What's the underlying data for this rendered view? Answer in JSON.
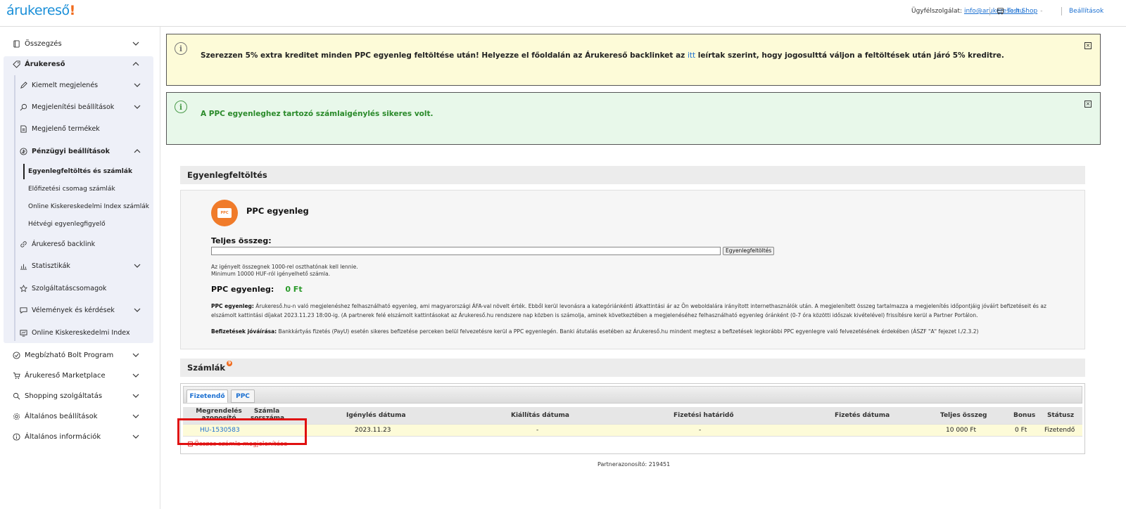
{
  "header": {
    "logo_text": "árukereső",
    "logo_bang": "!",
    "support_label": "Ügyfélszolgálat:",
    "support_email": "info@arukereso.hu",
    "shop_name": "Test Shop",
    "shop_suffix": "-",
    "settings_label": "Beállítások"
  },
  "sidebar": {
    "top_items": [
      {
        "label": "Összegzés",
        "icon": "summary-icon"
      },
      {
        "label": "Árukereső",
        "icon": "tag-icon"
      }
    ],
    "arukereso_sub": [
      {
        "label": "Kiemelt megjelenés",
        "icon": "pen-icon"
      },
      {
        "label": "Megjelenítési beállítások",
        "icon": "search-settings-icon"
      },
      {
        "label": "Megjelenő termékek",
        "icon": "document-icon"
      },
      {
        "label": "Pénzügyi beállítások",
        "icon": "money-icon"
      }
    ],
    "finance_sub": [
      {
        "label": "Egyenlegfeltöltés és számlák",
        "active": true
      },
      {
        "label": "Előfizetési csomag számlák"
      },
      {
        "label": "Online Kiskereskedelmi Index számlák"
      },
      {
        "label": "Hétvégi egyenlegfigyelő"
      }
    ],
    "arukereso_sub2": [
      {
        "label": "Árukereső backlink",
        "icon": "link-icon"
      },
      {
        "label": "Statisztikák",
        "icon": "chart-icon"
      },
      {
        "label": "Szolgáltatáscsomagok",
        "icon": "star-icon"
      },
      {
        "label": "Vélemények és kérdések",
        "icon": "chat-icon"
      },
      {
        "label": "Online Kiskereskedelmi Index",
        "icon": "index-icon"
      }
    ],
    "bottom_items": [
      {
        "label": "Megbízható Bolt Program",
        "icon": "check-circle-icon"
      },
      {
        "label": "Árukereső Marketplace",
        "icon": "cart-icon"
      },
      {
        "label": "Shopping szolgáltatás",
        "icon": "search-icon"
      },
      {
        "label": "Általános beállítások",
        "icon": "gear-icon"
      },
      {
        "label": "Általános információk",
        "icon": "info-icon"
      }
    ]
  },
  "notices": {
    "yellow": {
      "text_before": "Szerezzen 5% extra kreditet minden PPC egyenleg feltöltése után! Helyezze el főoldalán az Árukereső backlinket az ",
      "link": "itt",
      "text_after": " leírtak szerint, hogy jogosulttá váljon a feltöltések után járó 5% kreditre."
    },
    "green": {
      "text": "A PPC egyenleghez tartozó számlaigénylés sikeres volt."
    },
    "close_glyph": "×",
    "info_glyph": "i"
  },
  "balance": {
    "section_title": "Egyenlegfeltöltés",
    "wallet_text": "PPC",
    "ppc_title": "PPC egyenleg",
    "total_label": "Teljes összeg:",
    "topup_button": "Egyenlegfeltöltés",
    "hint1": "Az igényelt összegnek 1000-rel oszthatónak kell lennie.",
    "hint2": "Minimum 10000 HUF-ról igényelhető számla.",
    "balance_label": "PPC egyenleg:",
    "balance_amount": "0 Ft",
    "para1_bold": "PPC egyenleg:",
    "para1_text": " Árukereső.hu-n való megjelenéshez felhasználható egyenleg, ami magyarországi ÁFA-val növelt érték. Ebből kerül levonásra a kategóriánkénti átkattintási ár az Ön weboldalára irányított internethasználók után. A megjelenített összeg tartalmazza a megjelenítés időpontjáig jóváírt befizetéseit és az elszámolt kattintási díjakat 2023.11.23 18:00-ig. (A partnerek felé elszámolt kattintásokat az Árukereső.hu rendszere nap közben is számolja, aminek következtében a megjelenéséhez felhasználható egyenleg óránként (0-7 óra közötti időszak kivételével) frissítésre kerül a Partner Portálon.",
    "para2_bold": "Befizetések jóváírása:",
    "para2_text": " Bankkártyás fizetés (PayU) esetén sikeres befizetése perceken belül felvezetésre kerül a PPC egyenlegén. Banki átutalás esetében az Árukereső.hu mindent megtesz a befizetések legkorábbi PPC egyenlegre való felvezetésének érdekében (ÁSZF \"A\" fejezet I./2.3.2)"
  },
  "invoices": {
    "section_title": "Számlák",
    "badge": "9",
    "tabs": [
      "Fizetendő",
      "PPC"
    ],
    "headers": {
      "order_id": "Megrendelés azonosító",
      "invoice_no": "Számla sorszáma",
      "request_date": "Igénylés dátuma",
      "issue_date": "Kiállítás dátuma",
      "due_date": "Fizetési határidő",
      "payment_date": "Fizetés dátuma",
      "total": "Teljes összeg",
      "bonus": "Bonus",
      "status": "Státusz"
    },
    "row": {
      "order_id": "HU-1530583",
      "request_date": "2023.11.23",
      "issue_date": "-",
      "due_date": "-",
      "total": "10 000 Ft",
      "bonus": "0 Ft",
      "status": "Fizetendő"
    },
    "all_link": "Összes számla megjelenítése"
  },
  "footer": {
    "partner_id": "Partnerazonosító: 219451"
  },
  "colors": {
    "brand_blue": "#1a8fd8",
    "brand_orange": "#f06a1c",
    "highlight_red": "#e01010"
  }
}
